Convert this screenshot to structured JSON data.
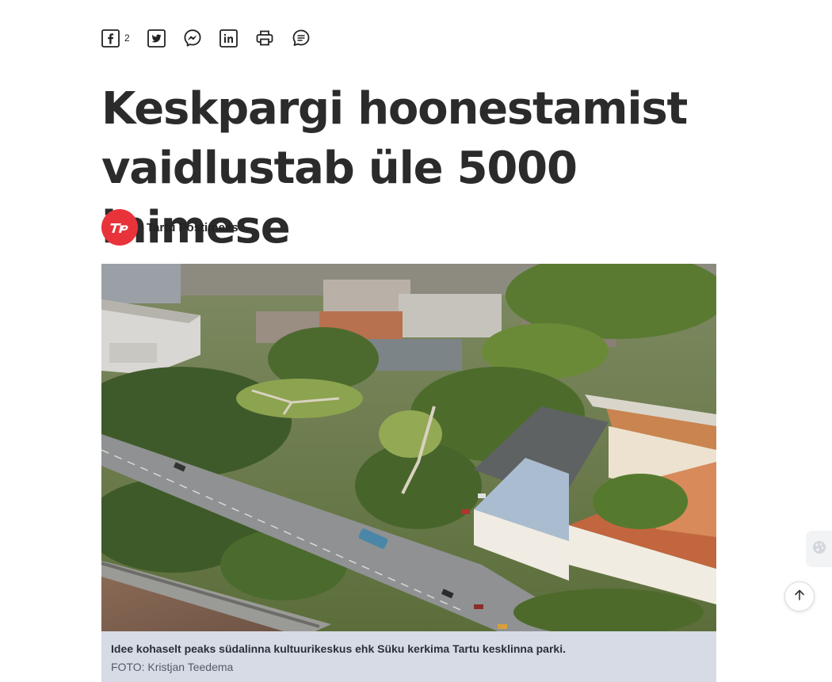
{
  "share": {
    "facebook_icon": "facebook-icon",
    "facebook_count": "2",
    "twitter_icon": "twitter-icon",
    "messenger_icon": "messenger-icon",
    "linkedin_icon": "linkedin-icon",
    "print_icon": "print-icon",
    "comments_icon": "comments-icon"
  },
  "article": {
    "title": "Keskpargi hoonestamist vaidlustab üle 5000 inimese",
    "author": {
      "name": "Tartu Postimees",
      "avatar_text": "TP",
      "avatar_color": "#e8333a"
    },
    "image": {
      "caption": "Idee kohaselt peaks südalinna kultuurikeskus ehk Süku kerkima Tartu kesklinna parki.",
      "credit": "FOTO: Kristjan Teedema"
    }
  },
  "widgets": {
    "side_icon": "palette-icon",
    "back_to_top_icon": "arrow-up-icon"
  },
  "colors": {
    "caption_bg": "#d6dbe6",
    "text": "#2b2b2b"
  }
}
